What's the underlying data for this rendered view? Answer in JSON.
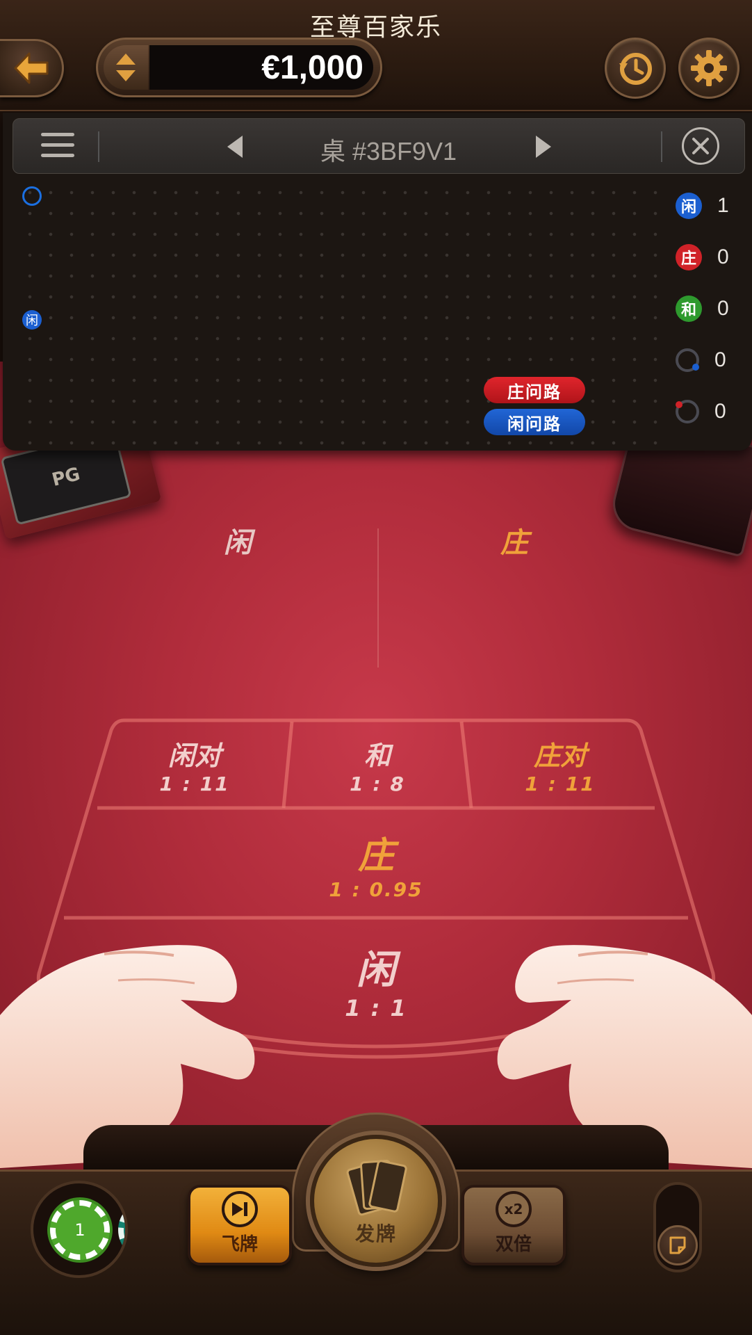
{
  "header": {
    "title": "至尊百家乐",
    "balance": "€1,000"
  },
  "roadmap": {
    "table_id": "桌 #3BF9V1",
    "player_marker": "闲",
    "ask_banker": "庄问路",
    "ask_player": "闲问路",
    "stats": [
      {
        "label": "闲",
        "count": "1",
        "color": "#1b5fd0"
      },
      {
        "label": "庄",
        "count": "0",
        "color": "#d02228"
      },
      {
        "label": "和",
        "count": "0",
        "color": "#2e9a2e"
      },
      {
        "label": "player-pair-icon",
        "count": "0",
        "color": "#1b5fd0"
      },
      {
        "label": "banker-pair-icon",
        "count": "0",
        "color": "#d02228"
      }
    ]
  },
  "table": {
    "player_area_label": "闲",
    "banker_area_label": "庄",
    "deck_logo": "PG",
    "bets": {
      "player_pair": {
        "name": "闲对",
        "odds": "1 : 11"
      },
      "tie": {
        "name": "和",
        "odds": "1 : 8"
      },
      "banker_pair": {
        "name": "庄对",
        "odds": "1 : 11"
      },
      "banker": {
        "name": "庄",
        "odds": "1 : 0.95"
      },
      "player": {
        "name": "闲",
        "odds": "1 : 1"
      }
    }
  },
  "controls": {
    "chip_value": "1",
    "fly_label": "飞牌",
    "deal_label": "发牌",
    "double_label": "双倍",
    "double_icon_text": "x2"
  },
  "colors": {
    "player_blue": "#1b5fd0",
    "banker_red": "#d02228",
    "tie_green": "#2e9a2e",
    "banker_gold": "#f0a23a",
    "felt_red": "#b02c3b"
  }
}
